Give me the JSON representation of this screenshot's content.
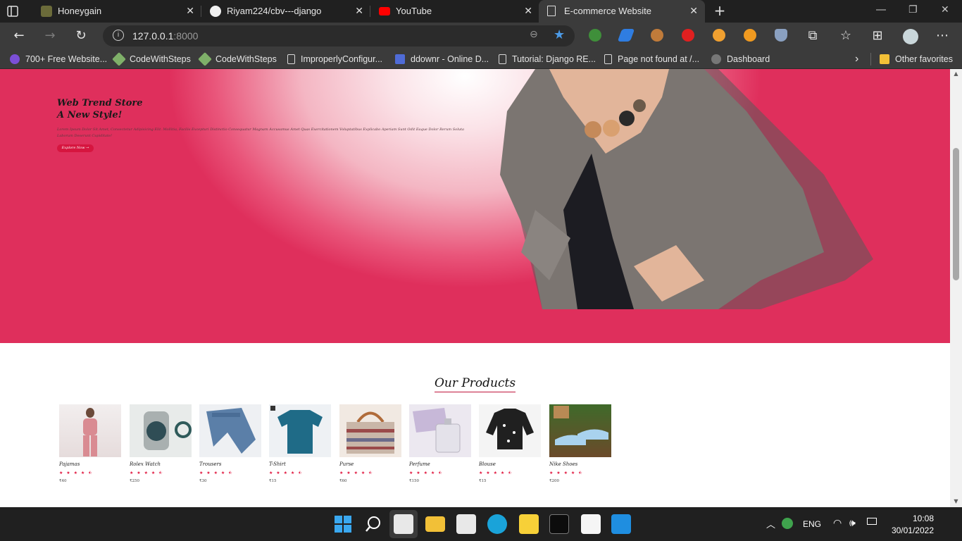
{
  "browser": {
    "tabs": [
      {
        "title": "Honeygain",
        "favicon_color": "#6b6b3a"
      },
      {
        "title": "Riyam224/cbv---django",
        "favicon_color": "#f0f0f0"
      },
      {
        "title": "YouTube",
        "favicon_color": "#ff0000"
      },
      {
        "title": "E-commerce Website",
        "favicon_color": "#dcdcdc"
      }
    ],
    "close_glyph": "✕",
    "new_tab_glyph": "+",
    "address": {
      "host": "127.0.0.1",
      "port": ":8000"
    },
    "bookmarks": [
      {
        "label": "700+ Free Website...",
        "icon_color": "#7b4fd6"
      },
      {
        "label": "CodeWithSteps",
        "icon_color": "#7fb069"
      },
      {
        "label": "CodeWithSteps",
        "icon_color": "#7fb069"
      },
      {
        "label": "ImproperlyConfigur...",
        "icon_color": "#d9d9d9"
      },
      {
        "label": "ddownr - Online D...",
        "icon_color": "#4f6bd6"
      },
      {
        "label": "Tutorial: Django RE...",
        "icon_color": "#d9d9d9"
      },
      {
        "label": "Page not found at /...",
        "icon_color": "#d9d9d9"
      },
      {
        "label": "Dashboard",
        "icon_color": "#777777"
      },
      {
        "label": "Other favorites",
        "icon_color": "#f2c037"
      }
    ]
  },
  "hero": {
    "title_line1": "Web Trend Store",
    "title_line2": "A New Style!",
    "body": "Lorem Ipsum Dolor Sit Amet, Consectetur Adipisicing Elit. Mollitia, Facilis Excepturi Distinctio Consequatur Magnam Accusamus Amet Quas Exercitationem Voluptatibus Explicabo Aperiam Sunt Odit Eaque Dolor Rerum Soluta Laborum Deserunt Cupiditate!",
    "button": "Explore Now →"
  },
  "products_section": {
    "title": "Our Products",
    "items": [
      {
        "name": "Pajamas",
        "rating": 4.5,
        "price": "₹40",
        "color": "#d98b92"
      },
      {
        "name": "Rolex Watch",
        "rating": 4.5,
        "price": "₹250",
        "color": "#7a8a86"
      },
      {
        "name": "Trousers",
        "rating": 4.5,
        "price": "₹30",
        "color": "#5b7fa8"
      },
      {
        "name": "T-Shirt",
        "rating": 4.5,
        "price": "₹15",
        "color": "#1f6b87"
      },
      {
        "name": "Purse",
        "rating": 4.5,
        "price": "₹60",
        "color": "#b06b3a"
      },
      {
        "name": "Perfume",
        "rating": 4.5,
        "price": "₹150",
        "color": "#d8d2e2"
      },
      {
        "name": "Blouse",
        "rating": 4.5,
        "price": "₹15",
        "color": "#202020"
      },
      {
        "name": "Nike Shoes",
        "rating": 4.5,
        "price": "₹200",
        "color": "#4f6a3a"
      }
    ],
    "stars_text": "★ ★ ★ ★ ⯪"
  },
  "taskbar": {
    "language": "ENG",
    "time": "10:08",
    "date": "30/01/2022"
  },
  "colors": {
    "accent": "#df2f5c",
    "button": "#d6153f"
  }
}
